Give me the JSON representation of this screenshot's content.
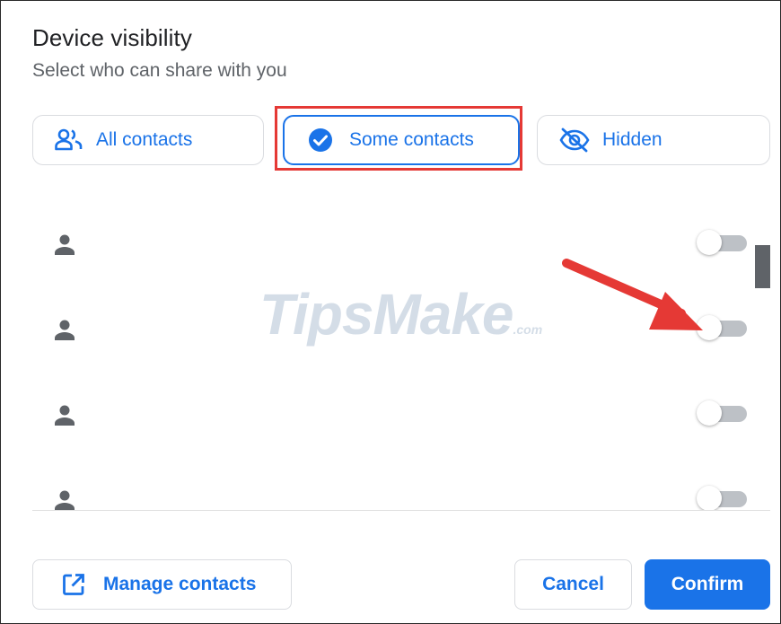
{
  "dialog": {
    "title": "Device visibility",
    "subtitle": "Select who can share with you"
  },
  "options": [
    {
      "label": "All contacts",
      "icon": "people-icon",
      "selected": false
    },
    {
      "label": "Some contacts",
      "icon": "check-circle-icon",
      "selected": true
    },
    {
      "label": "Hidden",
      "icon": "eye-off-icon",
      "selected": false
    }
  ],
  "contacts": [
    {
      "icon": "person-icon",
      "toggle_on": false
    },
    {
      "icon": "person-icon",
      "toggle_on": false
    },
    {
      "icon": "person-icon",
      "toggle_on": false
    },
    {
      "icon": "person-icon",
      "toggle_on": false
    }
  ],
  "footer": {
    "manage_label": "Manage contacts",
    "manage_icon": "open-in-new-icon",
    "cancel_label": "Cancel",
    "confirm_label": "Confirm"
  },
  "watermark": {
    "main": "TipsMake",
    "suffix": ".com"
  },
  "colors": {
    "accent": "#1a73e8",
    "annotation": "#e53935",
    "text_primary": "#202124",
    "text_secondary": "#5f6368"
  }
}
